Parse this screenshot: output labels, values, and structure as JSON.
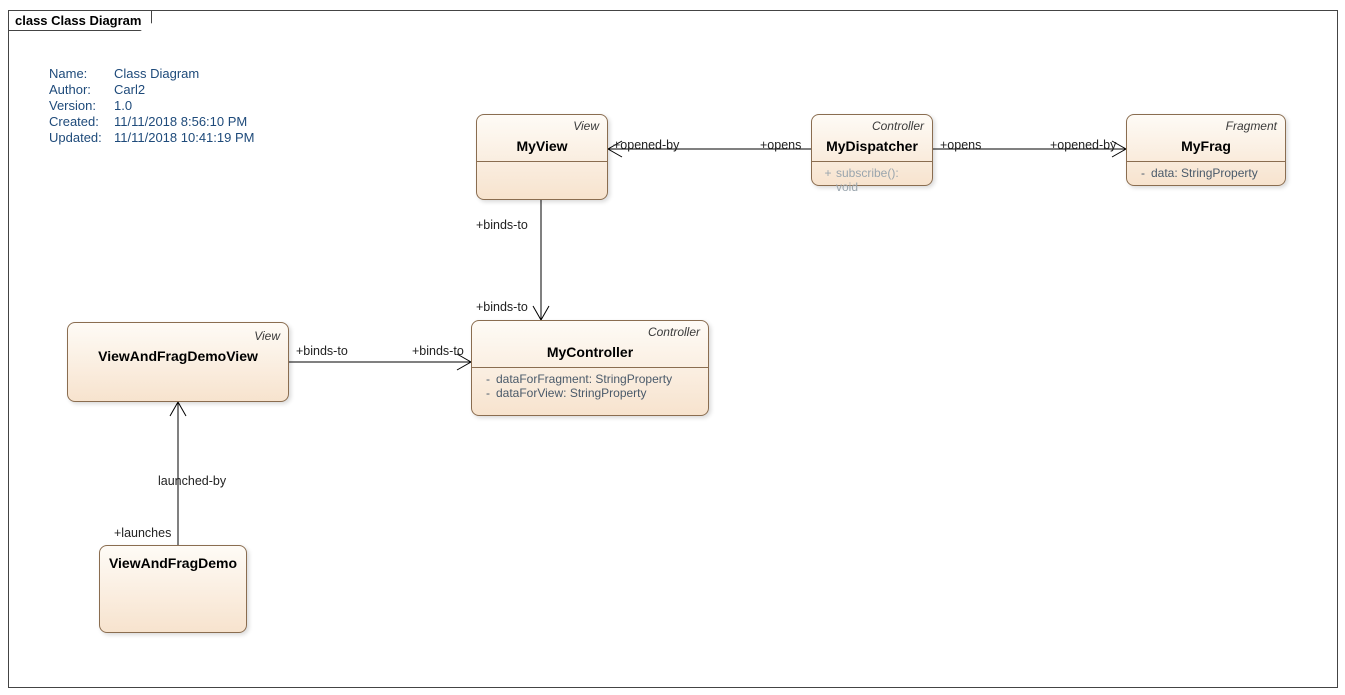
{
  "frame": {
    "title": "class Class Diagram"
  },
  "meta": {
    "name_label": "Name:",
    "name": "Class Diagram",
    "author_label": "Author:",
    "author": "Carl2",
    "version_label": "Version:",
    "version": "1.0",
    "created_label": "Created:",
    "created": "11/11/2018 8:56:10 PM",
    "updated_label": "Updated:",
    "updated": "11/11/2018 10:41:19 PM"
  },
  "classes": {
    "myview": {
      "stereo": "View",
      "name": "MyView"
    },
    "mydispatcher": {
      "stereo": "Controller",
      "name": "MyDispatcher",
      "op_vis": "+",
      "op": "subscribe(): void"
    },
    "myfrag": {
      "stereo": "Fragment",
      "name": "MyFrag",
      "attr_vis": "-",
      "attr": "data: StringProperty"
    },
    "viewandfragdemoview": {
      "stereo": "View",
      "name": "ViewAndFragDemoView"
    },
    "mycontroller": {
      "stereo": "Controller",
      "name": "MyController",
      "a1_vis": "-",
      "a1": "dataForFragment: StringProperty",
      "a2_vis": "-",
      "a2": "dataForView: StringProperty"
    },
    "viewandfragdemo": {
      "name": "ViewAndFragDemo"
    }
  },
  "labels": {
    "opened_by_1": "+opened-by",
    "opens_1": "+opens",
    "opens_2": "+opens",
    "opened_by_2": "+opened-by",
    "binds_to_1": "+binds-to",
    "binds_to_2": "+binds-to",
    "binds_to_3": "+binds-to",
    "binds_to_4": "+binds-to",
    "launched_by": "launched-by",
    "launches": "+launches"
  }
}
